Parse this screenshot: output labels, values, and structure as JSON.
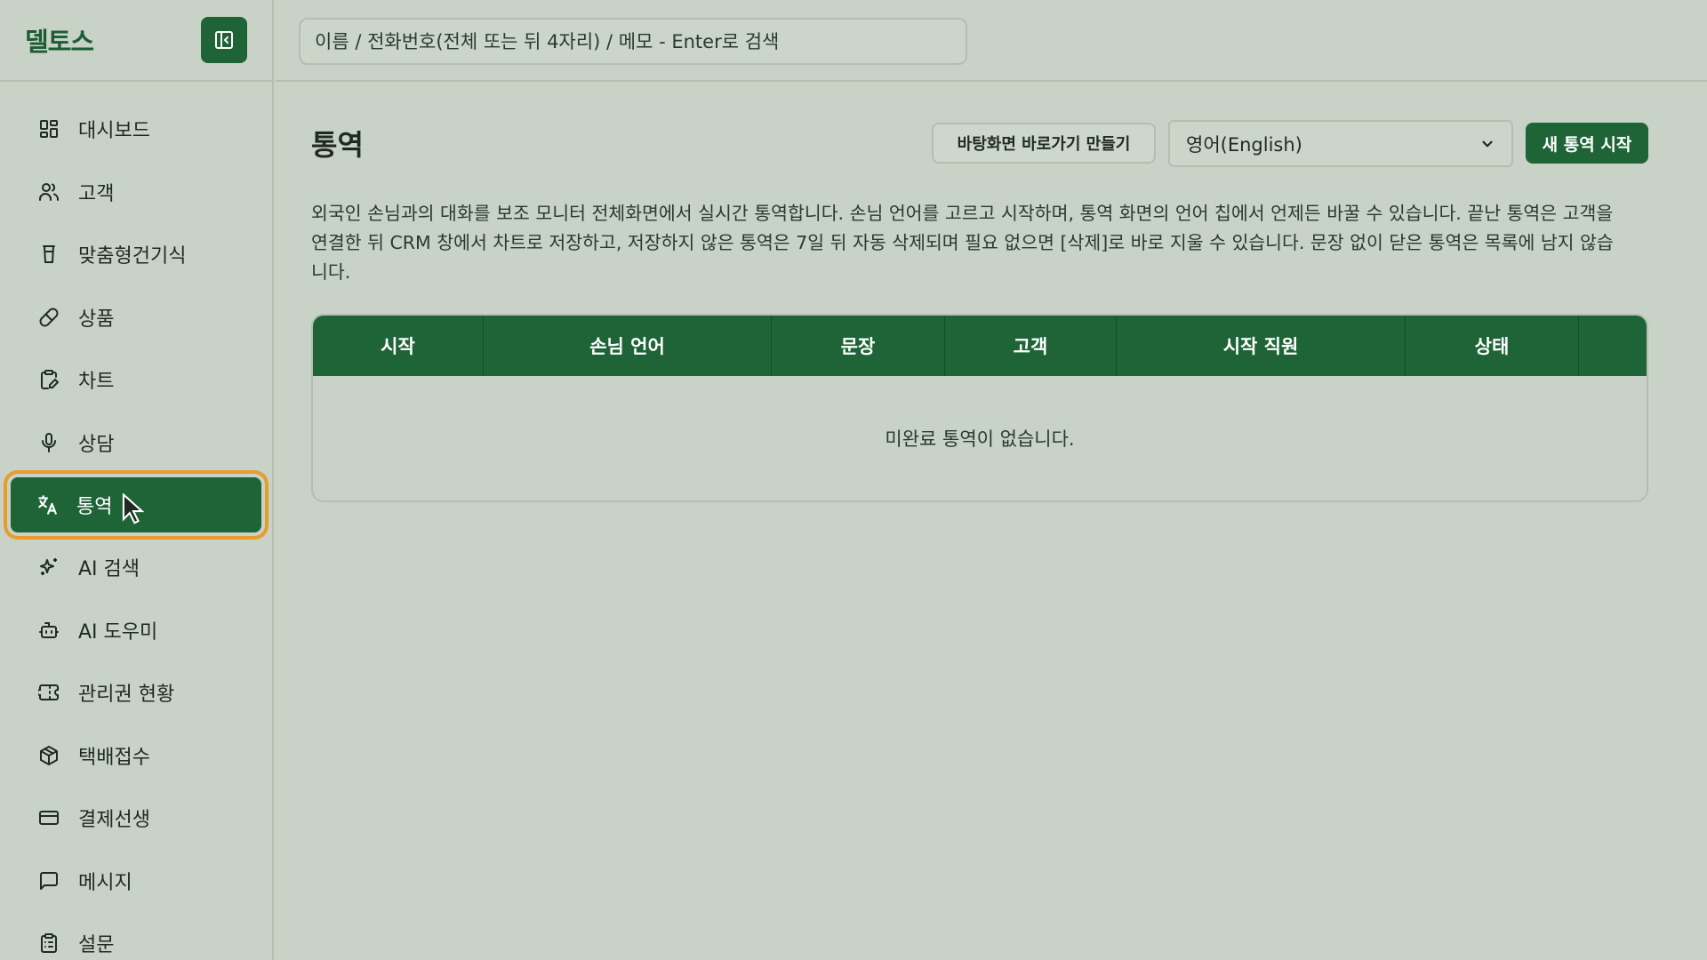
{
  "brand": "델토스",
  "search": {
    "placeholder": "이름 / 전화번호(전체 또는 뒤 4자리) / 메모 - Enter로 검색"
  },
  "sidebar": {
    "items": [
      {
        "label": "대시보드",
        "icon": "dashboard-grid-icon"
      },
      {
        "label": "고객",
        "icon": "users-icon"
      },
      {
        "label": "맞춤형건기식",
        "icon": "cup-icon"
      },
      {
        "label": "상품",
        "icon": "pill-icon"
      },
      {
        "label": "차트",
        "icon": "clipboard-edit-icon"
      },
      {
        "label": "상담",
        "icon": "microphone-icon"
      },
      {
        "label": "통역",
        "icon": "translate-icon",
        "active": true
      },
      {
        "label": "AI 검색",
        "icon": "sparkles-icon"
      },
      {
        "label": "AI 도우미",
        "icon": "bot-icon"
      },
      {
        "label": "관리권 현황",
        "icon": "ticket-icon"
      },
      {
        "label": "택배접수",
        "icon": "package-icon"
      },
      {
        "label": "결제선생",
        "icon": "credit-card-icon"
      },
      {
        "label": "메시지",
        "icon": "message-square-icon"
      },
      {
        "label": "설문",
        "icon": "clipboard-list-icon"
      }
    ]
  },
  "main": {
    "title": "통역",
    "shortcut_button": "바탕화면 바로가기 만들기",
    "language_select": "영어(English)",
    "new_button": "새 통역 시작",
    "description": "외국인 손님과의 대화를 보조 모니터 전체화면에서 실시간 통역합니다. 손님 언어를 고르고 시작하며, 통역 화면의 언어 칩에서 언제든 바꿀 수 있습니다. 끝난 통역은 고객을 연결한 뒤 CRM 창에서 차트로 저장하고, 저장하지 않은 통역은 7일 뒤 자동 삭제되며 필요 없으면 [삭제]로 바로 지울 수 있습니다. 문장 없이 닫은 통역은 목록에 남지 않습니다.",
    "table": {
      "columns": [
        "시작",
        "손님 언어",
        "문장",
        "고객",
        "시작 직원",
        "상태",
        ""
      ],
      "empty_text": "미완료 통역이 없습니다."
    }
  },
  "colors": {
    "accent": "#1e6437",
    "highlight": "#e89c2c",
    "background": "#c8d2c6"
  }
}
